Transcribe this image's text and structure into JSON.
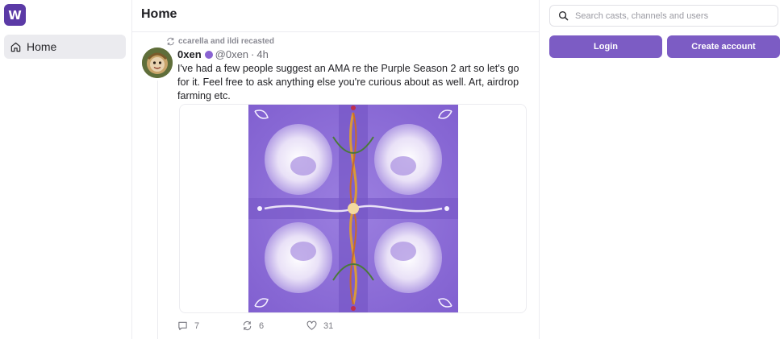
{
  "app": {
    "logo_letter": "W",
    "brand_color": "#5b3aa6",
    "accent_color": "#7c5cc4"
  },
  "sidebar": {
    "items": [
      {
        "label": "Home",
        "icon": "home-icon",
        "active": true
      }
    ]
  },
  "main": {
    "title": "Home",
    "feed": [
      {
        "recast_by": "ccarella and ildi recasted",
        "author_name": "0xen",
        "author_handle": "@0xen",
        "separator": "·",
        "time": "4h",
        "verified": true,
        "text": "I've had a few people suggest an AMA re the Purple Season 2 art so let's go for it. Feel free to ask anything else you're curious about as well. Art, airdrop farming etc.",
        "media": "purple-symmetric-artwork",
        "replies": "7",
        "recasts": "6",
        "likes": "31"
      }
    ]
  },
  "right_panel": {
    "search_placeholder": "Search casts, channels and users",
    "search_value": "",
    "login_label": "Login",
    "create_account_label": "Create account"
  }
}
